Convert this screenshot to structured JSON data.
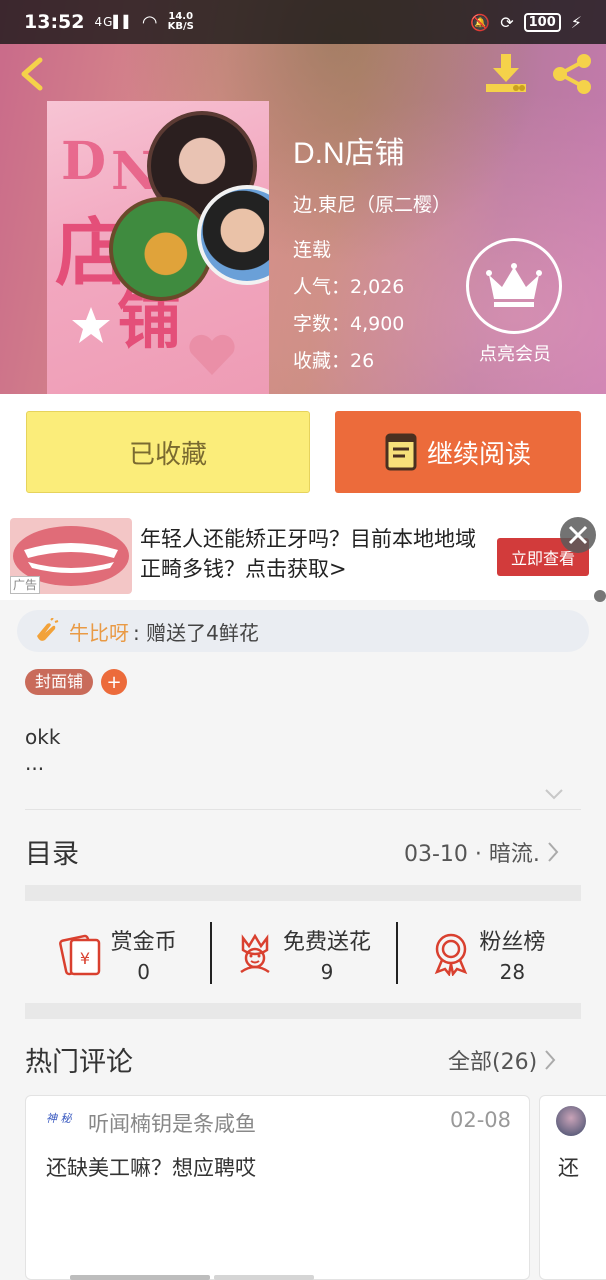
{
  "status_bar": {
    "time": "13:52",
    "network": "4G",
    "speed_value": "14.0",
    "speed_unit": "KB/S",
    "battery": "100"
  },
  "book": {
    "title": "D.N店铺",
    "author": "边.東尼（原二樱）",
    "status": "连载",
    "popularity": "人气：2,026",
    "word_count": "字数：4,900",
    "favorites": "收藏：26",
    "cover_glyphs": [
      "D",
      "N",
      "店",
      "铺"
    ]
  },
  "member": {
    "label": "点亮会员"
  },
  "actions": {
    "collected_label": "已收藏",
    "read_label": "继续阅读"
  },
  "ad": {
    "text": "年轻人还能矫正牙吗？目前本地地域正畸多钱？点击获取>",
    "cta": "立即查看",
    "tag": "广告"
  },
  "gift": {
    "user": "牛比呀",
    "message": ": 赠送了4鲜花"
  },
  "tags": [
    "封面铺"
  ],
  "tag_add": "+",
  "description": {
    "line1": "okk",
    "line2": "..."
  },
  "toc": {
    "title": "目录",
    "latest": "03-10 · 暗流."
  },
  "stats": [
    {
      "label": "赏金币",
      "value": "0",
      "icon": "envelope-coin-icon"
    },
    {
      "label": "免费送花",
      "value": "9",
      "icon": "flower-icon"
    },
    {
      "label": "粉丝榜",
      "value": "28",
      "icon": "medal-icon"
    }
  ],
  "comments": {
    "title": "热门评论",
    "all_label": "全部(26)",
    "items": [
      {
        "user": "听闻楠钥是条咸鱼",
        "date": "02-08",
        "text": "还缺美工嘛？想应聘哎",
        "avatar_text": "神 秘"
      },
      {
        "text": "还"
      }
    ]
  },
  "colors": {
    "accent_orange": "#ec6b3b",
    "collected_yellow": "#fbed7a",
    "gift_user": "#e99a45",
    "tag_brown": "#c96b5a",
    "ad_red": "#d23b3b"
  }
}
